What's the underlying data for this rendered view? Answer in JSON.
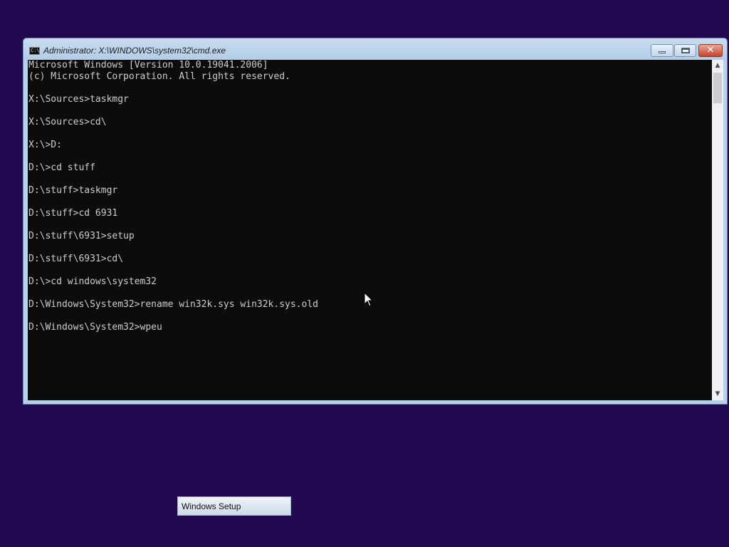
{
  "window": {
    "title": "Administrator: X:\\WINDOWS\\system32\\cmd.exe",
    "icon": "C:\\",
    "close_glyph": "✕"
  },
  "console": {
    "lines": [
      "Microsoft Windows [Version 10.0.19041.2006]",
      "(c) Microsoft Corporation. All rights reserved.",
      "",
      "X:\\Sources>taskmgr",
      "",
      "X:\\Sources>cd\\",
      "",
      "X:\\>D:",
      "",
      "D:\\>cd stuff",
      "",
      "D:\\stuff>taskmgr",
      "",
      "D:\\stuff>cd 6931",
      "",
      "D:\\stuff\\6931>setup",
      "",
      "D:\\stuff\\6931>cd\\",
      "",
      "D:\\>cd windows\\system32",
      "",
      "D:\\Windows\\System32>rename win32k.sys win32k.sys.old",
      "",
      "D:\\Windows\\System32>wpeu"
    ]
  },
  "scrollbar": {
    "up_glyph": "▲",
    "down_glyph": "▼"
  },
  "taskbar": {
    "setup_label": "Windows Setup"
  },
  "colors": {
    "desktop": "#21094f",
    "console_bg": "#0c0c0c",
    "console_text": "#cccccc",
    "frame": "#b7d1ea"
  }
}
